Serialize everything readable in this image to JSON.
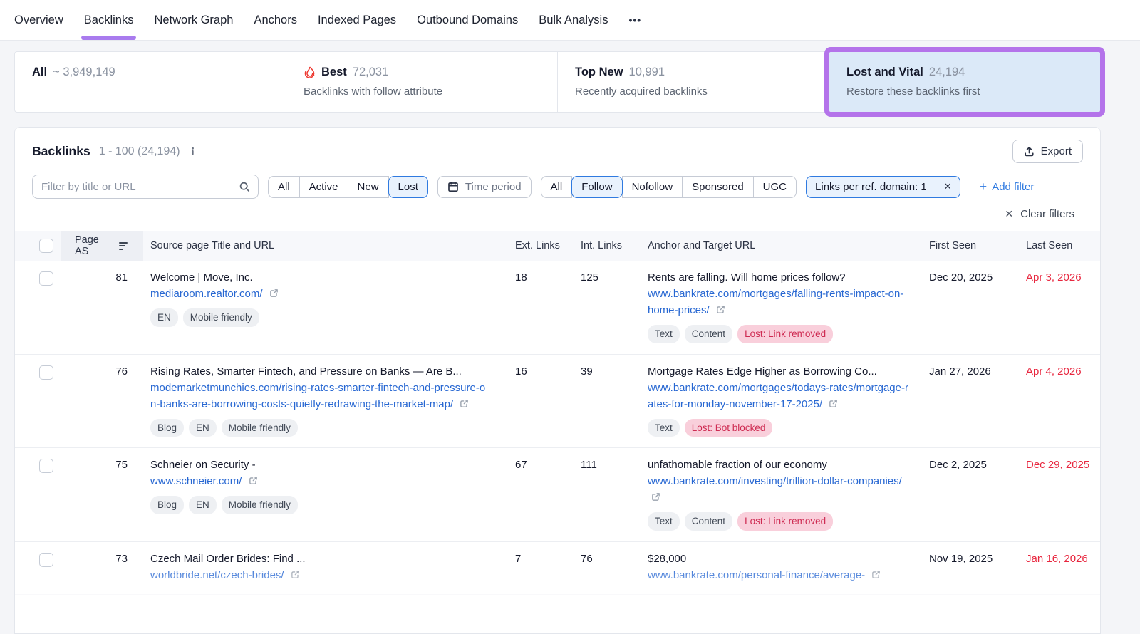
{
  "nav": {
    "tabs": [
      {
        "label": "Overview",
        "active": false
      },
      {
        "label": "Backlinks",
        "active": true
      },
      {
        "label": "Network Graph",
        "active": false
      },
      {
        "label": "Anchors",
        "active": false
      },
      {
        "label": "Indexed Pages",
        "active": false
      },
      {
        "label": "Outbound Domains",
        "active": false
      },
      {
        "label": "Bulk Analysis",
        "active": false
      }
    ],
    "more_label": "•••"
  },
  "summary_cards": [
    {
      "title": "All",
      "value": "~ 3,949,149",
      "subtitle": "",
      "icon": null,
      "highlighted": false
    },
    {
      "title": "Best",
      "value": "72,031",
      "subtitle": "Backlinks with follow attribute",
      "icon": "flame-icon",
      "highlighted": false
    },
    {
      "title": "Top New",
      "value": "10,991",
      "subtitle": "Recently acquired backlinks",
      "icon": null,
      "highlighted": false
    },
    {
      "title": "Lost and Vital",
      "value": "24,194",
      "subtitle": "Restore these backlinks first",
      "icon": null,
      "highlighted": true
    }
  ],
  "panel": {
    "title": "Backlinks",
    "range": "1 - 100 (24,194)",
    "export_label": "Export"
  },
  "filters": {
    "search_placeholder": "Filter by title or URL",
    "status_options": [
      "All",
      "Active",
      "New",
      "Lost"
    ],
    "status_selected": "Lost",
    "time_period_label": "Time period",
    "follow_options": [
      "All",
      "Follow",
      "Nofollow",
      "Sponsored",
      "UGC"
    ],
    "follow_selected": "Follow",
    "chip_label": "Links per ref. domain: 1",
    "add_filter_label": "Add filter",
    "clear_filters_label": "Clear filters"
  },
  "table": {
    "columns": [
      "Page AS",
      "Source page Title and URL",
      "Ext. Links",
      "Int. Links",
      "Anchor and Target URL",
      "First Seen",
      "Last Seen"
    ],
    "rows": [
      {
        "page_as": "81",
        "source_title": "Welcome | Move, Inc.",
        "source_url": "mediaroom.realtor.com/",
        "source_badges": [
          "EN",
          "Mobile friendly"
        ],
        "ext_links": "18",
        "int_links": "125",
        "anchor": "Rents are falling. Will home prices follow?",
        "target_url": "www.bankrate.com/mortgages/falling-rents-impact-on-home-prices/",
        "target_badges": [
          "Text",
          "Content"
        ],
        "lost_badge": "Lost: Link removed",
        "first_seen": "Dec 20, 2025",
        "last_seen": "Apr 3, 2026"
      },
      {
        "page_as": "76",
        "source_title": "Rising Rates, Smarter Fintech, and Pressure on Banks — Are B...",
        "source_url": "modemarketmunchies.com/rising-rates-smarter-fintech-and-pressure-on-banks-are-borrowing-costs-quietly-redrawing-the-market-map/",
        "source_badges": [
          "Blog",
          "EN",
          "Mobile friendly"
        ],
        "ext_links": "16",
        "int_links": "39",
        "anchor": "Mortgage Rates Edge Higher as Borrowing Co...",
        "target_url": "www.bankrate.com/mortgages/todays-rates/mortgage-rates-for-monday-november-17-2025/",
        "target_badges": [
          "Text"
        ],
        "lost_badge": "Lost: Bot blocked",
        "first_seen": "Jan 27, 2026",
        "last_seen": "Apr 4, 2026"
      },
      {
        "page_as": "75",
        "source_title": "Schneier on Security -",
        "source_url": "www.schneier.com/",
        "source_badges": [
          "Blog",
          "EN",
          "Mobile friendly"
        ],
        "ext_links": "67",
        "int_links": "111",
        "anchor": "unfathomable fraction of our economy",
        "target_url": "www.bankrate.com/investing/trillion-dollar-companies/",
        "target_badges": [
          "Text",
          "Content"
        ],
        "lost_badge": "Lost: Link removed",
        "first_seen": "Dec 2, 2025",
        "last_seen": "Dec 29, 2025"
      },
      {
        "page_as": "73",
        "source_title": "Czech Mail Order Brides: Find ...",
        "source_url": "worldbride.net/czech-brides/",
        "source_badges": [],
        "ext_links": "7",
        "int_links": "76",
        "anchor": "$28,000",
        "target_url": "www.bankrate.com/personal-finance/average-",
        "target_badges": [],
        "lost_badge": null,
        "first_seen": "Nov 19, 2025",
        "last_seen": "Jan 16, 2026"
      }
    ]
  },
  "colors": {
    "accent_purple": "#a97bee",
    "highlight_border": "#b473ea",
    "highlight_bg": "#dbe9f8",
    "selected_blue": "#2f7ae0",
    "link_blue": "#2767d2",
    "lost_red": "#e8273f",
    "lost_badge_bg": "#f9cfdb",
    "lost_badge_text": "#ce2b52",
    "flame_red": "#ee3b33"
  }
}
